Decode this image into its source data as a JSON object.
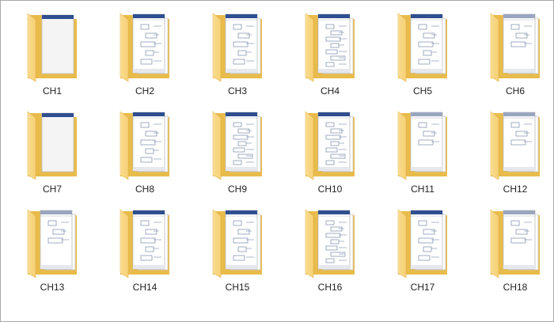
{
  "colors": {
    "folder_back": "#e8bb4a",
    "folder_front": "#f7d37a",
    "folder_front_light": "#fbe3a2",
    "doc_header": "#2f4f8f",
    "doc_line": "#7a8aa8"
  },
  "folders": [
    {
      "name": "CH1",
      "preview": "gray"
    },
    {
      "name": "CH2",
      "preview": "drawing"
    },
    {
      "name": "CH3",
      "preview": "drawing"
    },
    {
      "name": "CH4",
      "preview": "drawing-dense"
    },
    {
      "name": "CH5",
      "preview": "drawing"
    },
    {
      "name": "CH6",
      "preview": "drawing-light"
    },
    {
      "name": "CH7",
      "preview": "gray"
    },
    {
      "name": "CH8",
      "preview": "drawing"
    },
    {
      "name": "CH9",
      "preview": "drawing-dense"
    },
    {
      "name": "CH10",
      "preview": "drawing-dense"
    },
    {
      "name": "CH11",
      "preview": "drawing-light"
    },
    {
      "name": "CH12",
      "preview": "drawing-light"
    },
    {
      "name": "CH13",
      "preview": "drawing-light"
    },
    {
      "name": "CH14",
      "preview": "drawing"
    },
    {
      "name": "CH15",
      "preview": "drawing"
    },
    {
      "name": "CH16",
      "preview": "drawing-dense"
    },
    {
      "name": "CH17",
      "preview": "drawing"
    },
    {
      "name": "CH18",
      "preview": "drawing-light"
    }
  ]
}
